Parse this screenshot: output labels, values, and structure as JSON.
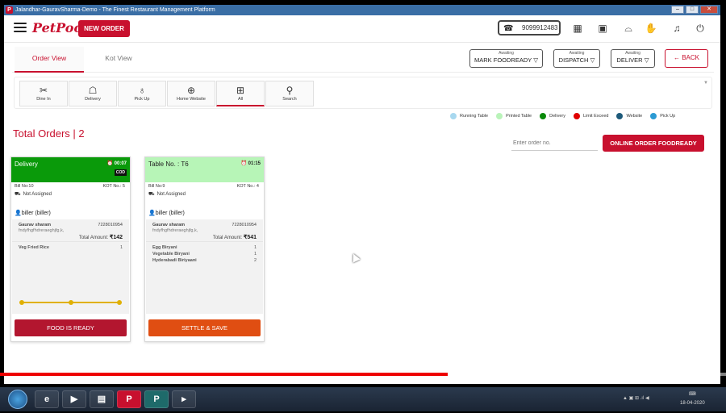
{
  "window": {
    "title": "Jalandhar-GauravSharma-Demo - The Finest Restaurant Management Platform"
  },
  "header": {
    "logo": "PetPooja",
    "new_order": "NEW ORDER",
    "phone": "9099912483",
    "icons": [
      "table-icon",
      "monitor-icon",
      "dome-icon",
      "hand-icon",
      "bell-icon",
      "power-icon"
    ]
  },
  "view_tabs": [
    {
      "label": "Order View",
      "active": true
    },
    {
      "label": "Kot View",
      "active": false
    }
  ],
  "await_buttons": [
    {
      "top": "Awaiting",
      "label": "MARK FOODREADY"
    },
    {
      "top": "Awaiting",
      "label": "DISPATCH"
    },
    {
      "top": "Awaiting",
      "label": "DELIVER"
    }
  ],
  "back_label": "BACK",
  "order_types": [
    {
      "label": "Dine In",
      "icon": "dine-in-icon"
    },
    {
      "label": "Delivery",
      "icon": "delivery-icon"
    },
    {
      "label": "Pick Up",
      "icon": "pickup-icon"
    },
    {
      "label": "Home Website",
      "icon": "globe-icon"
    },
    {
      "label": "All",
      "icon": "grid-icon",
      "active": true
    },
    {
      "label": "Search",
      "icon": "search-icon"
    }
  ],
  "total_orders": "Total Orders | 2",
  "legend": [
    {
      "label": "Running Table",
      "color": "#a8d8ef"
    },
    {
      "label": "Printed Table",
      "color": "#b9f3b9"
    },
    {
      "label": "Delivery",
      "color": "#0a8a0a"
    },
    {
      "label": "Limit Exceed",
      "color": "#e00000"
    },
    {
      "label": "Website",
      "color": "#1e5a7a"
    },
    {
      "label": "Pick Up",
      "color": "#2b9ad3"
    }
  ],
  "search": {
    "placeholder": "Enter order no."
  },
  "online_btn": "ONLINE ORDER FOODREADY",
  "cards": [
    {
      "title": "Delivery",
      "timer": "00:07",
      "cod": "COD",
      "header_color": "#0a9a0a",
      "bill": "Bill No:10",
      "kot": "KOT No.: 5",
      "status": "Not Assigned",
      "biller": "biller (biller)",
      "customer": "Gaurav sharam",
      "phone": "7228010954",
      "address": "fndyfhgfhdreraeghjfg,k,",
      "total_label": "Total Amount:",
      "total": "₹142",
      "items": [
        {
          "name": "Veg Fried Rice",
          "qty": "1"
        }
      ],
      "action": "FOOD IS READY",
      "action_color": "#b3162f"
    },
    {
      "title": "Table No. : T6",
      "timer": "01:15",
      "header_color": "#b7f5b7",
      "bill": "Bill No:9",
      "kot": "KOT No.: 4",
      "status": "Not Assigned",
      "biller": "biller (biller)",
      "customer": "Gaurav sharam",
      "phone": "7228010954",
      "address": "fndyfhgfhdreraeghjfg,k,",
      "total_label": "Total Amount:",
      "total": "₹541",
      "items": [
        {
          "name": "Egg Biryani",
          "qty": "1"
        },
        {
          "name": "Vegetable Biryani",
          "qty": "1"
        },
        {
          "name": "Hyderabadi Biriyaani",
          "qty": "2"
        }
      ],
      "action": "SETTLE & SAVE",
      "action_color": "#e04e12"
    }
  ],
  "video_progress": 0.617
}
